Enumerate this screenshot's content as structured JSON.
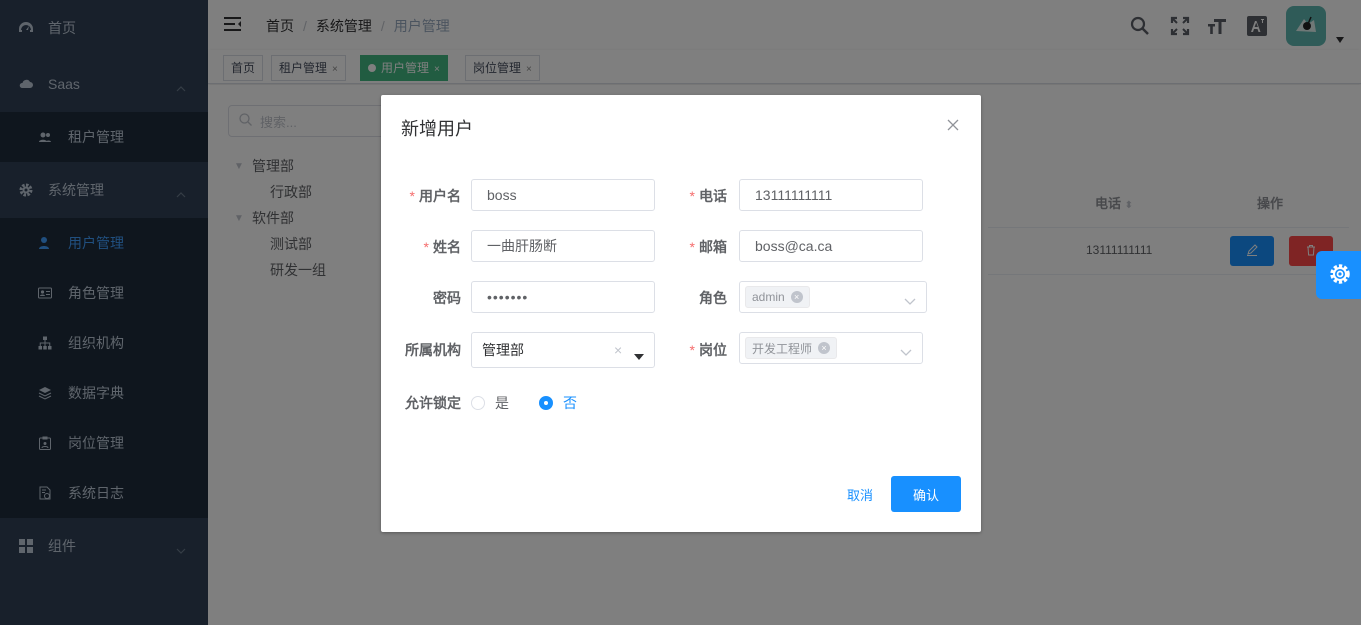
{
  "sidebar": {
    "home": "首页",
    "saas": "Saas",
    "saas_children": [
      "租户管理"
    ],
    "system": "系统管理",
    "system_children": [
      "用户管理",
      "角色管理",
      "组织机构",
      "数据字典",
      "岗位管理",
      "系统日志"
    ],
    "components": "组件"
  },
  "header": {
    "breadcrumb": [
      "首页",
      "系统管理",
      "用户管理"
    ],
    "separator": "/"
  },
  "tags": {
    "items": [
      "首页",
      "租户管理",
      "用户管理",
      "岗位管理"
    ],
    "close_glyph": "×"
  },
  "main": {
    "search_placeholder": "搜索...",
    "tree": {
      "root1": "管理部",
      "root1_children": [
        "行政部"
      ],
      "root2": "软件部",
      "root2_children": [
        "测试部",
        "研发一组"
      ]
    },
    "table": {
      "col_phone": "电话",
      "col_ops": "操作",
      "row_phone": "13111111111"
    }
  },
  "dialog": {
    "title": "新增用户",
    "fields": {
      "username_label": "用户名",
      "username_value": "boss",
      "phone_label": "电话",
      "phone_value": "13111111111",
      "nickname_label": "姓名",
      "nickname_value": "一曲肝肠断",
      "email_label": "邮箱",
      "email_value": "boss@ca.ca",
      "password_label": "密码",
      "password_value": "•••••••",
      "role_label": "角色",
      "role_tag": "admin",
      "dept_label": "所属机构",
      "dept_value": "管理部",
      "job_label": "岗位",
      "job_tag": "开发工程师",
      "lock_label": "允许锁定",
      "lock_yes": "是",
      "lock_no": "否"
    },
    "required_mark": "*",
    "cancel_label": "取消",
    "confirm_label": "确认"
  },
  "colors": {
    "sidebar_bg": "#304156",
    "accent": "#1890ff",
    "active_tag": "#42b983",
    "danger": "#ff4949",
    "required": "#f56c6c"
  }
}
